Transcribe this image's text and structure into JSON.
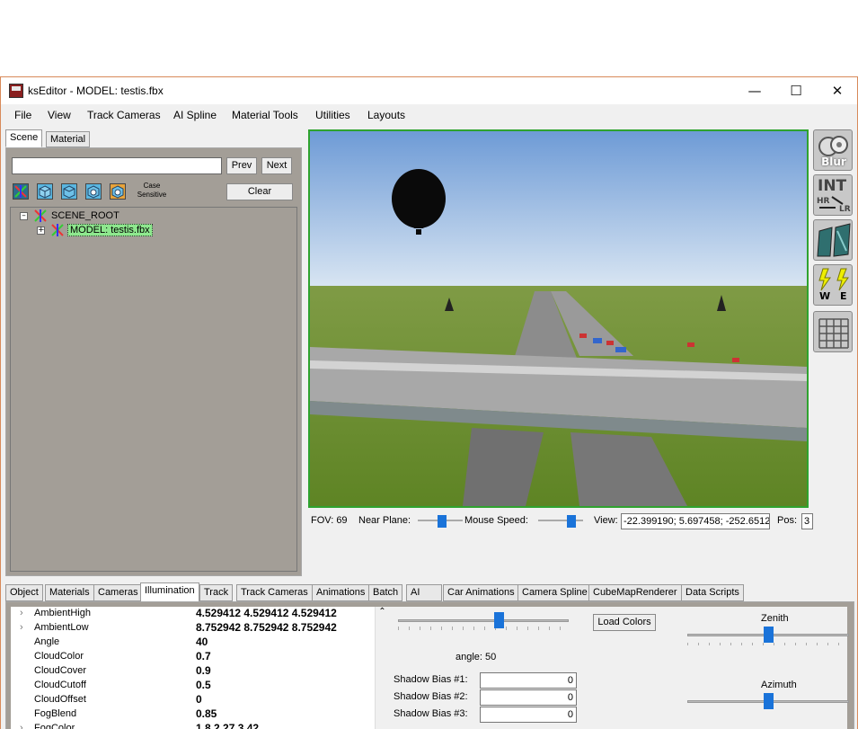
{
  "window": {
    "title": "ksEditor - MODEL: testis.fbx",
    "minimize": "—",
    "maximize": "☐",
    "close": "✕"
  },
  "menu": [
    "File",
    "View",
    "Track Cameras",
    "AI Spline",
    "Material Tools",
    "Utilities",
    "Layouts"
  ],
  "scene_panel": {
    "tabs": [
      "Scene",
      "Material"
    ],
    "search_value": "",
    "prev_label": "Prev",
    "next_label": "Next",
    "case_sensitive": "Case Sensitive",
    "clear_label": "Clear",
    "filter_icons": [
      "axes-icon",
      "cube-icon",
      "cube-icon",
      "sphere-cube-icon",
      "sphere-cube-icon"
    ],
    "tree": [
      {
        "label": "SCENE_ROOT",
        "expander": "–"
      },
      {
        "label": "MODEL: testis.fbx",
        "expander": "+"
      }
    ]
  },
  "viewport_status": {
    "fov_label": "FOV: 69",
    "near_plane_label": "Near Plane:",
    "near_plane_level": 0.55,
    "mouse_speed_label": "Mouse Speed:",
    "mouse_speed_level": 0.8,
    "view_label": "View:",
    "view_value": "-22.399190; 5.697458; -252.6512",
    "pos_label": "Pos:",
    "pos_value": "3"
  },
  "right_toolbar": {
    "blur_label": "Blur",
    "int_label": "INT",
    "hr_label": "HR",
    "lr_label": "LR",
    "w_label": "W",
    "e_label": "E"
  },
  "bottom_tabs": [
    "Object",
    "Materials",
    "Cameras",
    "Illumination",
    "Track",
    "Track Cameras",
    "Animations",
    "Batch",
    "AI",
    "Car Animations",
    "Camera Spline",
    "CubeMapRenderer",
    "Data Scripts"
  ],
  "selected_bottom_tab": "Illumination",
  "properties": [
    {
      "name": "AmbientHigh",
      "value": "4.529412 4.529412 4.529412",
      "expandable": true
    },
    {
      "name": "AmbientLow",
      "value": "8.752942 8.752942 8.752942",
      "expandable": true
    },
    {
      "name": "Angle",
      "value": "40",
      "expandable": false
    },
    {
      "name": "CloudColor",
      "value": "0.7",
      "expandable": false
    },
    {
      "name": "CloudCover",
      "value": "0.9",
      "expandable": false
    },
    {
      "name": "CloudCutoff",
      "value": "0.5",
      "expandable": false
    },
    {
      "name": "CloudOffset",
      "value": "0",
      "expandable": false
    },
    {
      "name": "FogBlend",
      "value": "0.85",
      "expandable": false
    },
    {
      "name": "FogColor",
      "value": "1.8 2.27 3.42",
      "expandable": true
    }
  ],
  "illumination": {
    "angle_slider_level": 0.6,
    "angle_label": "angle: 50",
    "load_colors_label": "Load Colors",
    "shadow_bias_1_label": "Shadow Bias #1:",
    "shadow_bias_1_value": "0",
    "shadow_bias_2_label": "Shadow Bias #2:",
    "shadow_bias_2_value": "0",
    "shadow_bias_3_label": "Shadow Bias #3:",
    "shadow_bias_3_value": "0",
    "zenith_label": "Zenith",
    "zenith_level": 0.5,
    "azimuth_label": "Azimuth",
    "azimuth_level": 0.5
  },
  "colors": {
    "panel_bg": "#a39e97",
    "viewport_border": "#2fa32f",
    "selected_tree_item": "#8ee88e",
    "slider_thumb": "#1a73d9"
  }
}
